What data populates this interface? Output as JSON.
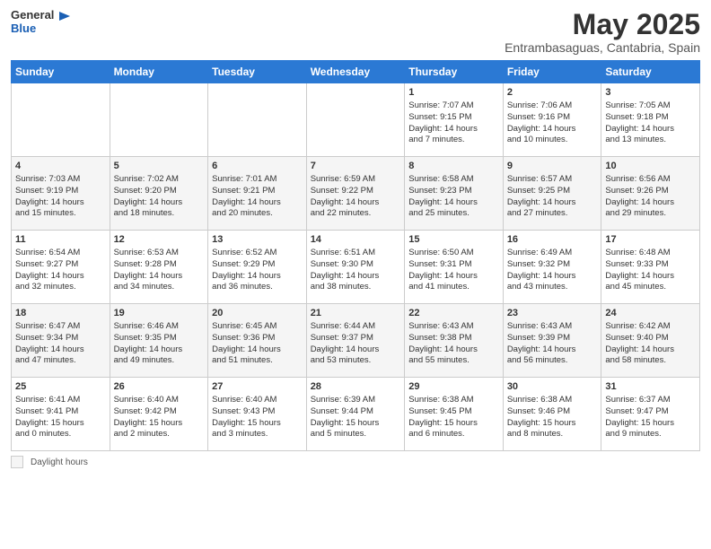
{
  "header": {
    "logo_general": "General",
    "logo_blue": "Blue",
    "month_title": "May 2025",
    "subtitle": "Entrambasaguas, Cantabria, Spain"
  },
  "days_of_week": [
    "Sunday",
    "Monday",
    "Tuesday",
    "Wednesday",
    "Thursday",
    "Friday",
    "Saturday"
  ],
  "weeks": [
    [
      {
        "num": "",
        "lines": []
      },
      {
        "num": "",
        "lines": []
      },
      {
        "num": "",
        "lines": []
      },
      {
        "num": "",
        "lines": []
      },
      {
        "num": "1",
        "lines": [
          "Sunrise: 7:07 AM",
          "Sunset: 9:15 PM",
          "Daylight: 14 hours",
          "and 7 minutes."
        ]
      },
      {
        "num": "2",
        "lines": [
          "Sunrise: 7:06 AM",
          "Sunset: 9:16 PM",
          "Daylight: 14 hours",
          "and 10 minutes."
        ]
      },
      {
        "num": "3",
        "lines": [
          "Sunrise: 7:05 AM",
          "Sunset: 9:18 PM",
          "Daylight: 14 hours",
          "and 13 minutes."
        ]
      }
    ],
    [
      {
        "num": "4",
        "lines": [
          "Sunrise: 7:03 AM",
          "Sunset: 9:19 PM",
          "Daylight: 14 hours",
          "and 15 minutes."
        ]
      },
      {
        "num": "5",
        "lines": [
          "Sunrise: 7:02 AM",
          "Sunset: 9:20 PM",
          "Daylight: 14 hours",
          "and 18 minutes."
        ]
      },
      {
        "num": "6",
        "lines": [
          "Sunrise: 7:01 AM",
          "Sunset: 9:21 PM",
          "Daylight: 14 hours",
          "and 20 minutes."
        ]
      },
      {
        "num": "7",
        "lines": [
          "Sunrise: 6:59 AM",
          "Sunset: 9:22 PM",
          "Daylight: 14 hours",
          "and 22 minutes."
        ]
      },
      {
        "num": "8",
        "lines": [
          "Sunrise: 6:58 AM",
          "Sunset: 9:23 PM",
          "Daylight: 14 hours",
          "and 25 minutes."
        ]
      },
      {
        "num": "9",
        "lines": [
          "Sunrise: 6:57 AM",
          "Sunset: 9:25 PM",
          "Daylight: 14 hours",
          "and 27 minutes."
        ]
      },
      {
        "num": "10",
        "lines": [
          "Sunrise: 6:56 AM",
          "Sunset: 9:26 PM",
          "Daylight: 14 hours",
          "and 29 minutes."
        ]
      }
    ],
    [
      {
        "num": "11",
        "lines": [
          "Sunrise: 6:54 AM",
          "Sunset: 9:27 PM",
          "Daylight: 14 hours",
          "and 32 minutes."
        ]
      },
      {
        "num": "12",
        "lines": [
          "Sunrise: 6:53 AM",
          "Sunset: 9:28 PM",
          "Daylight: 14 hours",
          "and 34 minutes."
        ]
      },
      {
        "num": "13",
        "lines": [
          "Sunrise: 6:52 AM",
          "Sunset: 9:29 PM",
          "Daylight: 14 hours",
          "and 36 minutes."
        ]
      },
      {
        "num": "14",
        "lines": [
          "Sunrise: 6:51 AM",
          "Sunset: 9:30 PM",
          "Daylight: 14 hours",
          "and 38 minutes."
        ]
      },
      {
        "num": "15",
        "lines": [
          "Sunrise: 6:50 AM",
          "Sunset: 9:31 PM",
          "Daylight: 14 hours",
          "and 41 minutes."
        ]
      },
      {
        "num": "16",
        "lines": [
          "Sunrise: 6:49 AM",
          "Sunset: 9:32 PM",
          "Daylight: 14 hours",
          "and 43 minutes."
        ]
      },
      {
        "num": "17",
        "lines": [
          "Sunrise: 6:48 AM",
          "Sunset: 9:33 PM",
          "Daylight: 14 hours",
          "and 45 minutes."
        ]
      }
    ],
    [
      {
        "num": "18",
        "lines": [
          "Sunrise: 6:47 AM",
          "Sunset: 9:34 PM",
          "Daylight: 14 hours",
          "and 47 minutes."
        ]
      },
      {
        "num": "19",
        "lines": [
          "Sunrise: 6:46 AM",
          "Sunset: 9:35 PM",
          "Daylight: 14 hours",
          "and 49 minutes."
        ]
      },
      {
        "num": "20",
        "lines": [
          "Sunrise: 6:45 AM",
          "Sunset: 9:36 PM",
          "Daylight: 14 hours",
          "and 51 minutes."
        ]
      },
      {
        "num": "21",
        "lines": [
          "Sunrise: 6:44 AM",
          "Sunset: 9:37 PM",
          "Daylight: 14 hours",
          "and 53 minutes."
        ]
      },
      {
        "num": "22",
        "lines": [
          "Sunrise: 6:43 AM",
          "Sunset: 9:38 PM",
          "Daylight: 14 hours",
          "and 55 minutes."
        ]
      },
      {
        "num": "23",
        "lines": [
          "Sunrise: 6:43 AM",
          "Sunset: 9:39 PM",
          "Daylight: 14 hours",
          "and 56 minutes."
        ]
      },
      {
        "num": "24",
        "lines": [
          "Sunrise: 6:42 AM",
          "Sunset: 9:40 PM",
          "Daylight: 14 hours",
          "and 58 minutes."
        ]
      }
    ],
    [
      {
        "num": "25",
        "lines": [
          "Sunrise: 6:41 AM",
          "Sunset: 9:41 PM",
          "Daylight: 15 hours",
          "and 0 minutes."
        ]
      },
      {
        "num": "26",
        "lines": [
          "Sunrise: 6:40 AM",
          "Sunset: 9:42 PM",
          "Daylight: 15 hours",
          "and 2 minutes."
        ]
      },
      {
        "num": "27",
        "lines": [
          "Sunrise: 6:40 AM",
          "Sunset: 9:43 PM",
          "Daylight: 15 hours",
          "and 3 minutes."
        ]
      },
      {
        "num": "28",
        "lines": [
          "Sunrise: 6:39 AM",
          "Sunset: 9:44 PM",
          "Daylight: 15 hours",
          "and 5 minutes."
        ]
      },
      {
        "num": "29",
        "lines": [
          "Sunrise: 6:38 AM",
          "Sunset: 9:45 PM",
          "Daylight: 15 hours",
          "and 6 minutes."
        ]
      },
      {
        "num": "30",
        "lines": [
          "Sunrise: 6:38 AM",
          "Sunset: 9:46 PM",
          "Daylight: 15 hours",
          "and 8 minutes."
        ]
      },
      {
        "num": "31",
        "lines": [
          "Sunrise: 6:37 AM",
          "Sunset: 9:47 PM",
          "Daylight: 15 hours",
          "and 9 minutes."
        ]
      }
    ]
  ],
  "footer": {
    "daylight_label": "Daylight hours"
  }
}
